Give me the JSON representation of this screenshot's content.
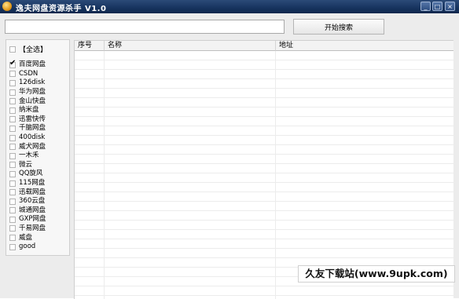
{
  "window": {
    "title": "逸夫网盘资源杀手 V1.0",
    "controls": {
      "minimize": "_",
      "maximize": "□",
      "close": "×"
    }
  },
  "search": {
    "value": "",
    "placeholder": "",
    "button_label": "开始搜索"
  },
  "sites": {
    "select_all": {
      "label": "【全选】",
      "checked": false
    },
    "items": [
      {
        "label": "百度网盘",
        "checked": true
      },
      {
        "label": "CSDN",
        "checked": false
      },
      {
        "label": "126disk",
        "checked": false
      },
      {
        "label": "华为网盘",
        "checked": false
      },
      {
        "label": "金山快盘",
        "checked": false
      },
      {
        "label": "纳米盘",
        "checked": false
      },
      {
        "label": "迅雷快传",
        "checked": false
      },
      {
        "label": "千脑网盘",
        "checked": false
      },
      {
        "label": "400disk",
        "checked": false
      },
      {
        "label": "威犬网盘",
        "checked": false
      },
      {
        "label": "一木禾",
        "checked": false
      },
      {
        "label": "微云",
        "checked": false
      },
      {
        "label": "QQ旋风",
        "checked": false
      },
      {
        "label": "115网盘",
        "checked": false
      },
      {
        "label": "迅载网盘",
        "checked": false
      },
      {
        "label": "360云盘",
        "checked": false
      },
      {
        "label": "城通网盘",
        "checked": false
      },
      {
        "label": "GXP网盘",
        "checked": false
      },
      {
        "label": "千易网盘",
        "checked": false
      },
      {
        "label": "威盘",
        "checked": false
      },
      {
        "label": "good",
        "checked": false
      }
    ]
  },
  "results_table": {
    "columns": [
      {
        "key": "index",
        "label": "序号"
      },
      {
        "key": "name",
        "label": "名称"
      },
      {
        "key": "address",
        "label": "地址"
      }
    ],
    "rows": []
  },
  "watermark": {
    "text": "久友下载站(www.9upk.com)"
  }
}
